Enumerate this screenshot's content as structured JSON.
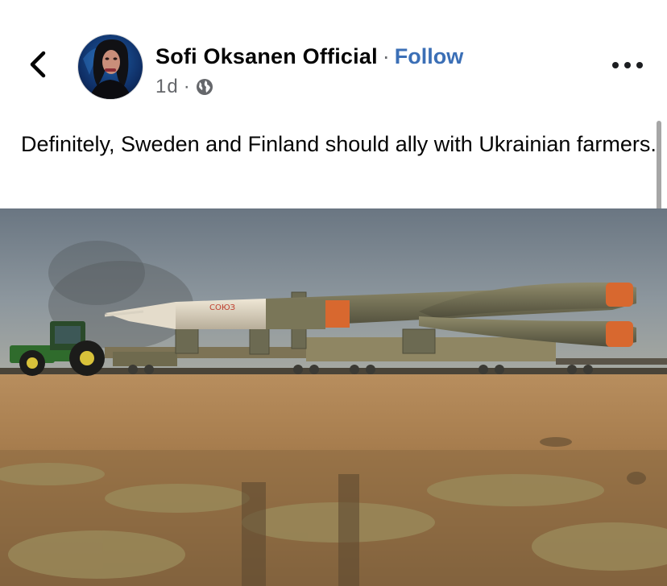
{
  "post": {
    "author": "Sofi Oksanen Official",
    "separator": "·",
    "follow_label": "Follow",
    "time": "1d",
    "meta_separator": "·",
    "privacy_icon": "globe-icon",
    "text": "Definitely, Sweden and Finland should ally with Ukrainian farmers."
  },
  "icons": {
    "back": "chevron-left-icon",
    "more": "more-horizontal-icon"
  },
  "colors": {
    "follow_link": "#3b6fb6",
    "meta_text": "#65676b",
    "background": "#ffffff"
  },
  "photo": {
    "rocket_marking": "СОЮЗ"
  }
}
